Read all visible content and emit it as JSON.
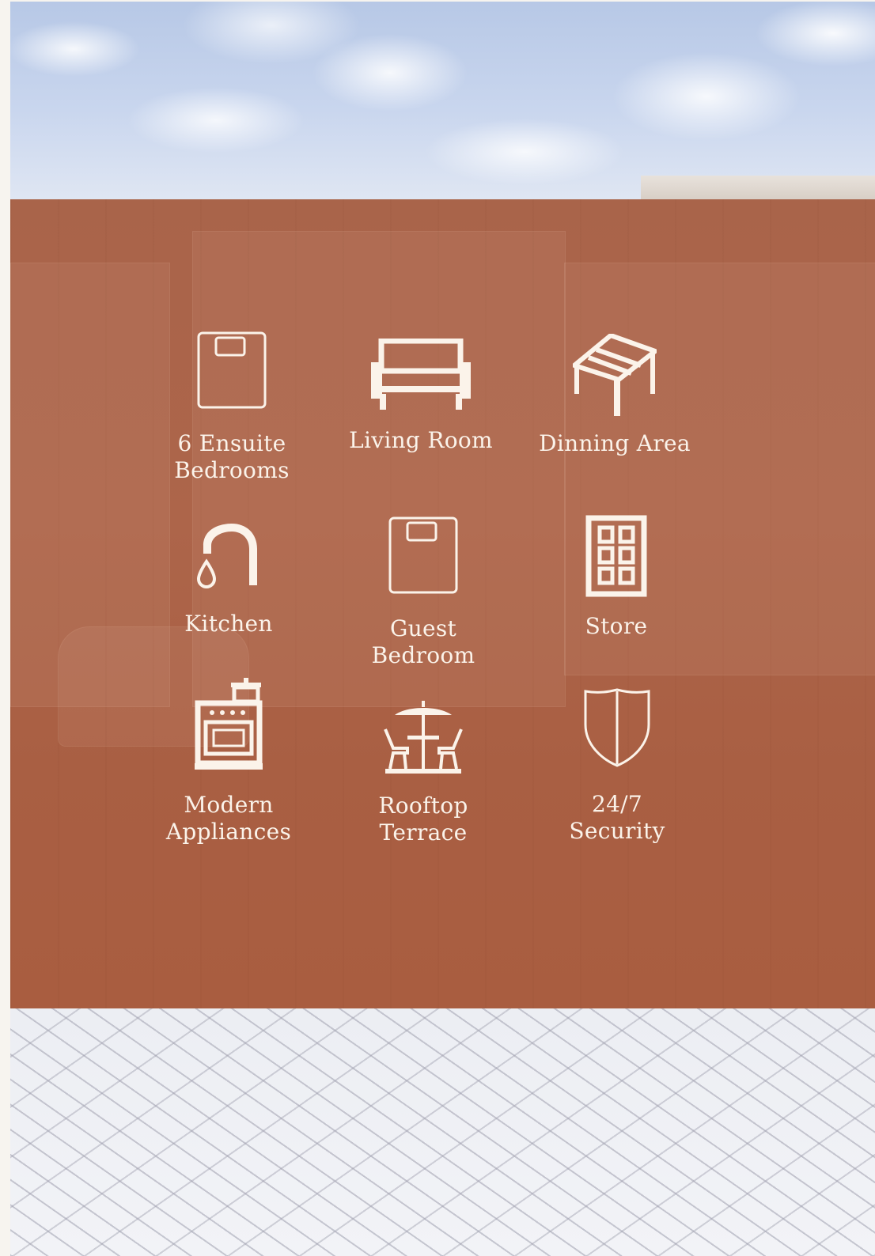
{
  "features": {
    "bedrooms": {
      "label": "6 Ensuite\nBedrooms",
      "icon": "bed-icon"
    },
    "living_room": {
      "label": "Living Room",
      "icon": "sofa-icon"
    },
    "dining": {
      "label": "Dinning Area",
      "icon": "table-icon"
    },
    "kitchen": {
      "label": "Kitchen",
      "icon": "faucet-icon"
    },
    "guest_room": {
      "label": "Guest\nBedroom",
      "icon": "bed-icon"
    },
    "store": {
      "label": "Store",
      "icon": "cabinet-icon"
    },
    "appliances": {
      "label": "Modern\nAppliances",
      "icon": "stove-icon"
    },
    "rooftop": {
      "label": "Rooftop\nTerrace",
      "icon": "patio-umbrella-icon"
    },
    "security": {
      "label": "24/7\nSecurity",
      "icon": "shield-icon"
    }
  },
  "colors": {
    "panel": "#ab6247",
    "icon_text": "#fbf3ea",
    "sky": "#c9d6ee",
    "paving": "#eceef3"
  }
}
